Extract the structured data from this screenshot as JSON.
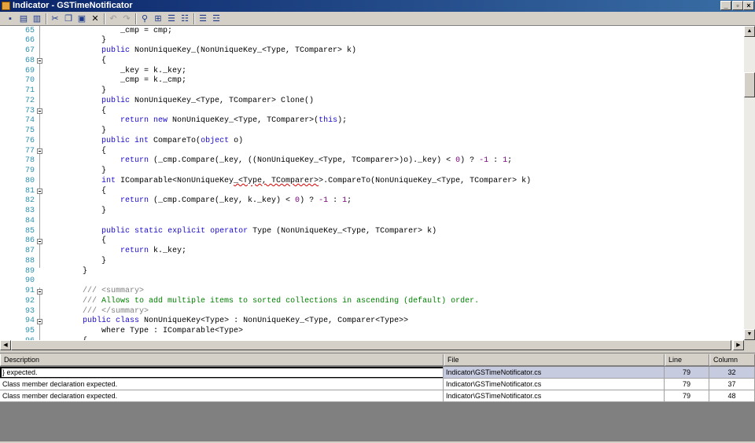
{
  "window": {
    "title": "Indicator - GSTimeNotificator"
  },
  "toolbar": {
    "icons": [
      "save-icon",
      "print-icon",
      "print-preview-icon",
      "cut-icon",
      "copy-icon",
      "paste-icon",
      "delete-icon",
      "undo-icon",
      "redo-icon",
      "find-icon",
      "find-replace-icon",
      "indent-icon",
      "outdent-icon",
      "comment-icon",
      "uncomment-icon"
    ]
  },
  "editor": {
    "line_numbers": [
      "65",
      "66",
      "67",
      "68",
      "69",
      "70",
      "71",
      "72",
      "73",
      "74",
      "75",
      "76",
      "77",
      "78",
      "79",
      "80",
      "81",
      "82",
      "83",
      "84",
      "85",
      "86",
      "87",
      "88",
      "89",
      "90",
      "91",
      "92",
      "93",
      "94",
      "95",
      "96"
    ],
    "lines": [
      "_cmp = cmp;",
      "}",
      "public NonUniqueKey_(NonUniqueKey_<Type, TComparer> k)",
      "{",
      "_key = k._key;",
      "_cmp = k._cmp;",
      "}",
      "public NonUniqueKey_<Type, TComparer> Clone()",
      "{",
      "return new NonUniqueKey_<Type, TComparer>(this);",
      "}",
      "public int CompareTo(object o)",
      "{",
      "return (_cmp.Compare(_key, ((NonUniqueKey_<Type, TComparer>)o)._key) < 0) ? -1 : 1;",
      "}",
      "int IComparable<NonUniqueKey_<Type, TComparer>>.CompareTo(NonUniqueKey_<Type, TComparer> k)",
      "{",
      "return (_cmp.Compare(_key, k._key) < 0) ? -1 : 1;",
      "}",
      "",
      "public static explicit operator Type (NonUniqueKey_<Type, TComparer> k)",
      "{",
      "return k._key;",
      "}",
      "}",
      "",
      "/// <summary>",
      "/// Allows to add multiple items to sorted collections in ascending (default) order.",
      "/// </summary>",
      "public class NonUniqueKey<Type> : NonUniqueKey_<Type, Comparer<Type>>",
      "where Type : IComparable<Type>",
      "{"
    ]
  },
  "error_list": {
    "columns": [
      "Description",
      "File",
      "Line",
      "Column"
    ],
    "rows": [
      {
        "description": "} expected.",
        "file": "Indicator\\GSTimeNotificator.cs",
        "line": "79",
        "column": "32"
      },
      {
        "description": "Class member declaration expected.",
        "file": "Indicator\\GSTimeNotificator.cs",
        "line": "79",
        "column": "37"
      },
      {
        "description": "Class member declaration expected.",
        "file": "Indicator\\GSTimeNotificator.cs",
        "line": "79",
        "column": "48"
      }
    ]
  }
}
